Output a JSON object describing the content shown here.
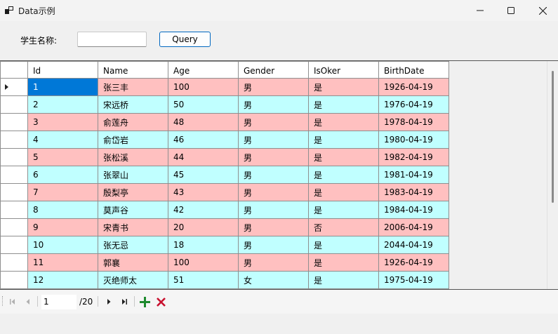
{
  "window": {
    "title": "Data示例",
    "icon": "app-window-icon"
  },
  "filter": {
    "label": "学生名称:",
    "input_value": "",
    "query_label": "Query"
  },
  "grid": {
    "columns": [
      "Id",
      "Name",
      "Age",
      "Gender",
      "IsOker",
      "BirthDate"
    ],
    "rows": [
      {
        "Id": "1",
        "Name": "张三丰",
        "Age": "100",
        "Gender": "男",
        "IsOker": "是",
        "BirthDate": "1926-04-19",
        "color": "pink"
      },
      {
        "Id": "2",
        "Name": "宋远桥",
        "Age": "50",
        "Gender": "男",
        "IsOker": "是",
        "BirthDate": "1976-04-19",
        "color": "cyan"
      },
      {
        "Id": "3",
        "Name": "俞莲舟",
        "Age": "48",
        "Gender": "男",
        "IsOker": "是",
        "BirthDate": "1978-04-19",
        "color": "pink"
      },
      {
        "Id": "4",
        "Name": "俞岱岩",
        "Age": "46",
        "Gender": "男",
        "IsOker": "是",
        "BirthDate": "1980-04-19",
        "color": "cyan"
      },
      {
        "Id": "5",
        "Name": "张松溪",
        "Age": "44",
        "Gender": "男",
        "IsOker": "是",
        "BirthDate": "1982-04-19",
        "color": "pink"
      },
      {
        "Id": "6",
        "Name": "张翠山",
        "Age": "45",
        "Gender": "男",
        "IsOker": "是",
        "BirthDate": "1981-04-19",
        "color": "cyan"
      },
      {
        "Id": "7",
        "Name": "殷梨亭",
        "Age": "43",
        "Gender": "男",
        "IsOker": "是",
        "BirthDate": "1983-04-19",
        "color": "pink"
      },
      {
        "Id": "8",
        "Name": "莫声谷",
        "Age": "42",
        "Gender": "男",
        "IsOker": "是",
        "BirthDate": "1984-04-19",
        "color": "cyan"
      },
      {
        "Id": "9",
        "Name": "宋青书",
        "Age": "20",
        "Gender": "男",
        "IsOker": "否",
        "BirthDate": "2006-04-19",
        "color": "pink"
      },
      {
        "Id": "10",
        "Name": "张无忌",
        "Age": "18",
        "Gender": "男",
        "IsOker": "是",
        "BirthDate": "2044-04-19",
        "color": "cyan"
      },
      {
        "Id": "11",
        "Name": "郭襄",
        "Age": "100",
        "Gender": "男",
        "IsOker": "是",
        "BirthDate": "1926-04-19",
        "color": "pink"
      },
      {
        "Id": "12",
        "Name": "灭绝师太",
        "Age": "51",
        "Gender": "女",
        "IsOker": "是",
        "BirthDate": "1975-04-19",
        "color": "cyan"
      }
    ],
    "selected_row": 0,
    "colors": {
      "pink": "#ffc0c0",
      "cyan": "#c0ffff",
      "selected": "#0078d7"
    }
  },
  "navigator": {
    "position": "1",
    "count_label": "/20"
  }
}
